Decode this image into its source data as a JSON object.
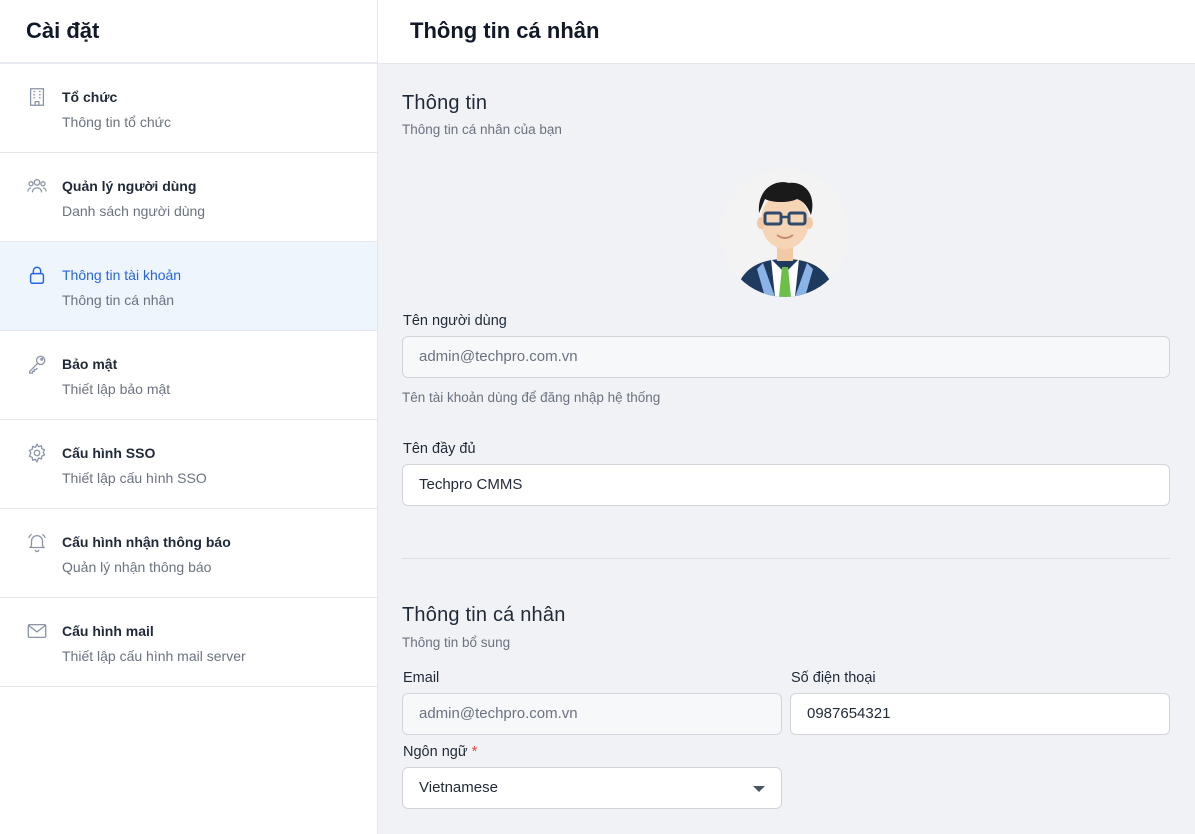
{
  "sidebar": {
    "title": "Cài đặt",
    "items": [
      {
        "label": "Tổ chức",
        "sub": "Thông tin tổ chức",
        "icon": "building-icon",
        "active": false
      },
      {
        "label": "Quản lý người dùng",
        "sub": "Danh sách người dùng",
        "icon": "users-icon",
        "active": false
      },
      {
        "label": "Thông tin tài khoản",
        "sub": "Thông tin cá nhân",
        "icon": "lock-icon",
        "active": true
      },
      {
        "label": "Bảo mật",
        "sub": "Thiết lập bảo mật",
        "icon": "key-icon",
        "active": false
      },
      {
        "label": "Cấu hình SSO",
        "sub": "Thiết lập cấu hình SSO",
        "icon": "gear-icon",
        "active": false
      },
      {
        "label": "Cấu hình nhận thông báo",
        "sub": "Quản lý nhận thông báo",
        "icon": "bell-icon",
        "active": false
      },
      {
        "label": "Cấu hình mail",
        "sub": "Thiết lập cấu hình mail server",
        "icon": "mail-icon",
        "active": false
      }
    ]
  },
  "header": {
    "title": "Thông tin cá nhân"
  },
  "info": {
    "title": "Thông tin",
    "subtitle": "Thông tin cá nhân của bạn",
    "username_label": "Tên người dùng",
    "username_value": "admin@techpro.com.vn",
    "username_helper": "Tên tài khoản dùng để đăng nhập hệ thống",
    "fullname_label": "Tên đầy đủ",
    "fullname_value": "Techpro CMMS"
  },
  "personal": {
    "title": "Thông tin cá nhân",
    "subtitle": "Thông tin bổ sung",
    "email_label": "Email",
    "email_value": "admin@techpro.com.vn",
    "phone_label": "Số điện thoại",
    "phone_value": "0987654321",
    "language_label": "Ngôn ngữ",
    "required_mark": "*",
    "language_value": "Vietnamese"
  },
  "colors": {
    "accent": "#2563eb",
    "active_bg": "#eff5fd",
    "main_bg": "#f0f2f6",
    "required": "#ef4444"
  }
}
